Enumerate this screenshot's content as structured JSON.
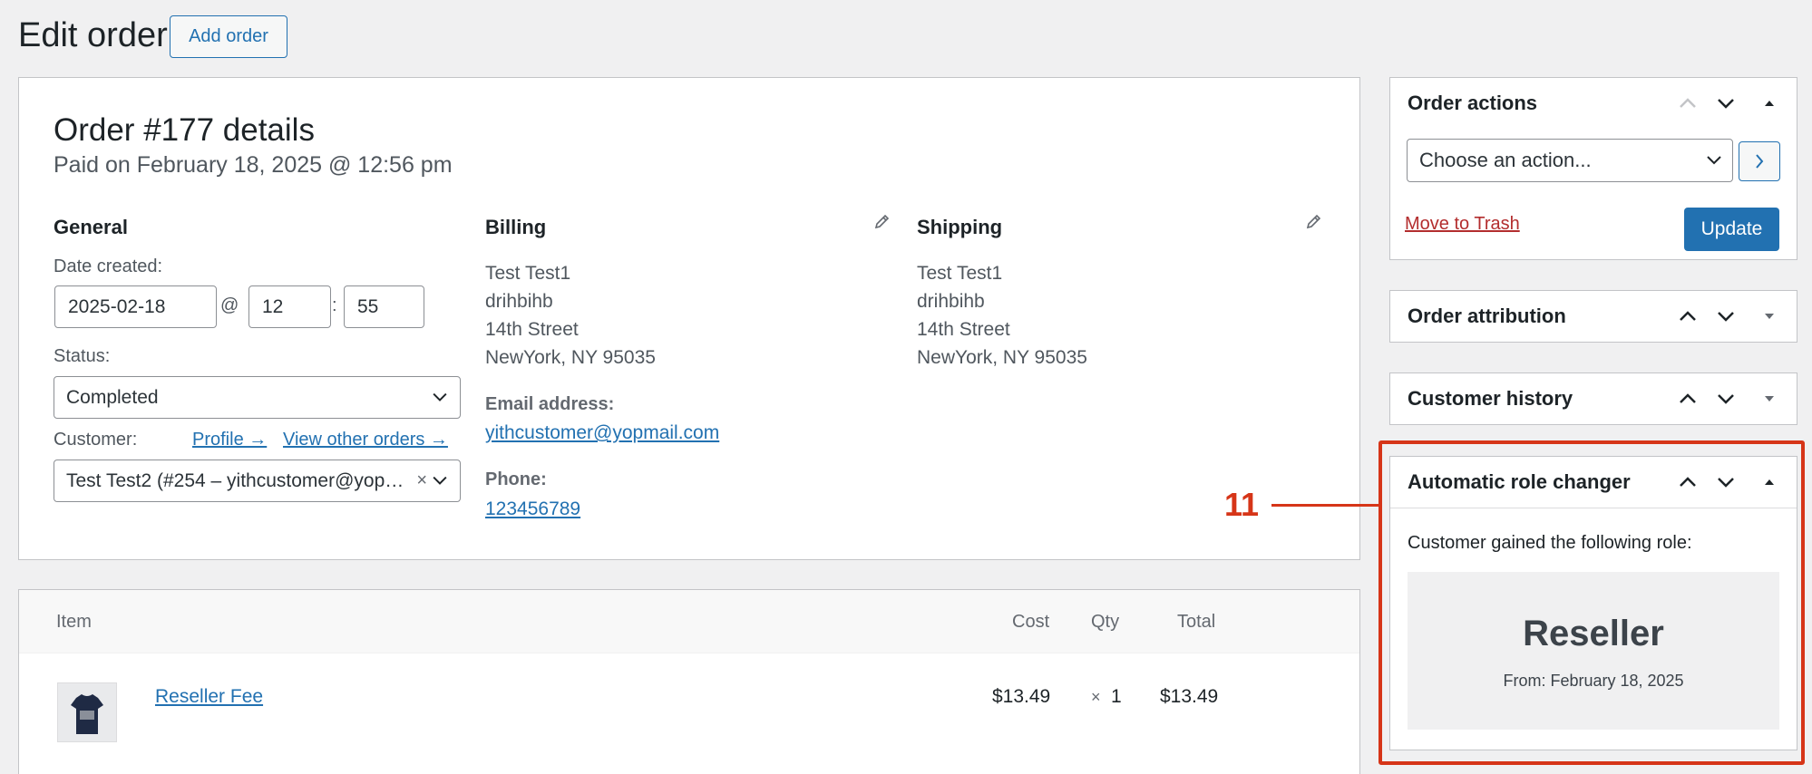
{
  "page": {
    "title": "Edit order",
    "add_order_label": "Add order"
  },
  "order": {
    "heading": "Order #177 details",
    "subheading": "Paid on February 18, 2025 @ 12:56 pm",
    "general": {
      "title": "General",
      "date_label": "Date created:",
      "date_value": "2025-02-18",
      "at": "@",
      "hour": "12",
      "colon": ":",
      "minute": "55",
      "status_label": "Status:",
      "status_value": "Completed",
      "customer_label": "Customer:",
      "profile_link": "Profile →",
      "other_orders_link": "View other orders →",
      "customer_value": "Test Test2 (#254 – yithcustomer@yop…",
      "clear_glyph": "×"
    },
    "billing": {
      "title": "Billing",
      "lines": [
        "Test Test1",
        "drihbihb",
        "14th Street",
        "NewYork, NY 95035"
      ],
      "email_label": "Email address:",
      "email": "yithcustomer@yopmail.com",
      "phone_label": "Phone:",
      "phone": "123456789"
    },
    "shipping": {
      "title": "Shipping",
      "lines": [
        "Test Test1",
        "drihbihb",
        "14th Street",
        "NewYork, NY 95035"
      ]
    }
  },
  "items": {
    "headers": {
      "item": "Item",
      "cost": "Cost",
      "qty": "Qty",
      "total": "Total"
    },
    "rows": [
      {
        "name": "Reseller Fee",
        "cost": "$13.49",
        "qty_prefix": "×",
        "qty": "1",
        "total": "$13.49",
        "thumb_icon": "tshirt-product-image"
      }
    ]
  },
  "sidebar": {
    "order_actions": {
      "title": "Order actions",
      "select_value": "Choose an action...",
      "trash_label": "Move to Trash",
      "update_label": "Update"
    },
    "order_attribution": {
      "title": "Order attribution"
    },
    "customer_history": {
      "title": "Customer history"
    },
    "role_changer": {
      "title": "Automatic role changer",
      "intro": "Customer gained the following role:",
      "role": "Reseller",
      "from": "From: February 18, 2025"
    }
  },
  "annotation": {
    "number": "11",
    "color": "#d63518"
  },
  "colors": {
    "accent": "#2271b1",
    "danger": "#b32d2e"
  }
}
